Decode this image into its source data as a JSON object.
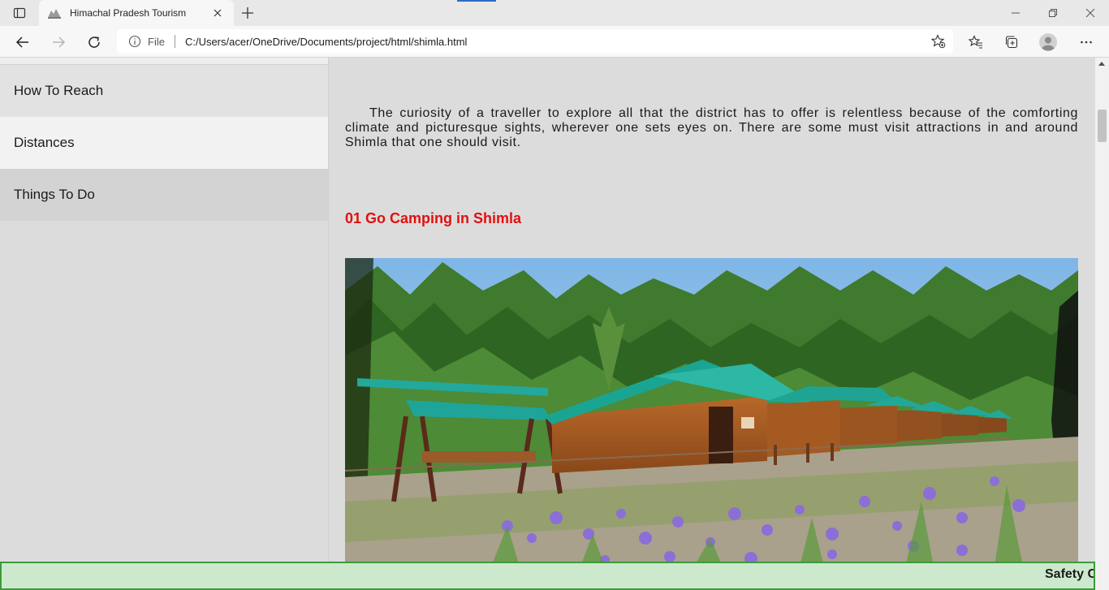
{
  "browser": {
    "tab_title": "Himachal Pradesh Tourism",
    "address_scheme": "File",
    "address_url": "C:/Users/acer/OneDrive/Documents/project/html/shimla.html"
  },
  "sidebar": {
    "items": [
      {
        "label": "How To Reach"
      },
      {
        "label": "Distances"
      },
      {
        "label": "Things To Do"
      }
    ]
  },
  "main": {
    "intro": "The curiosity of a traveller to explore all that the district has to offer is relentless because of the comforting climate and picturesque sights, wherever one sets eyes on. There are some must visit attractions in and around Shimla that one should visit.",
    "section_title": "01 Go Camping in Shimla",
    "title_color": "#e01010"
  },
  "marquee": {
    "text": "Safety C"
  },
  "colors": {
    "marquee_bg": "#cde9cd",
    "marquee_border": "#3b9b3b",
    "tab_accent": "#2b6cc4"
  }
}
